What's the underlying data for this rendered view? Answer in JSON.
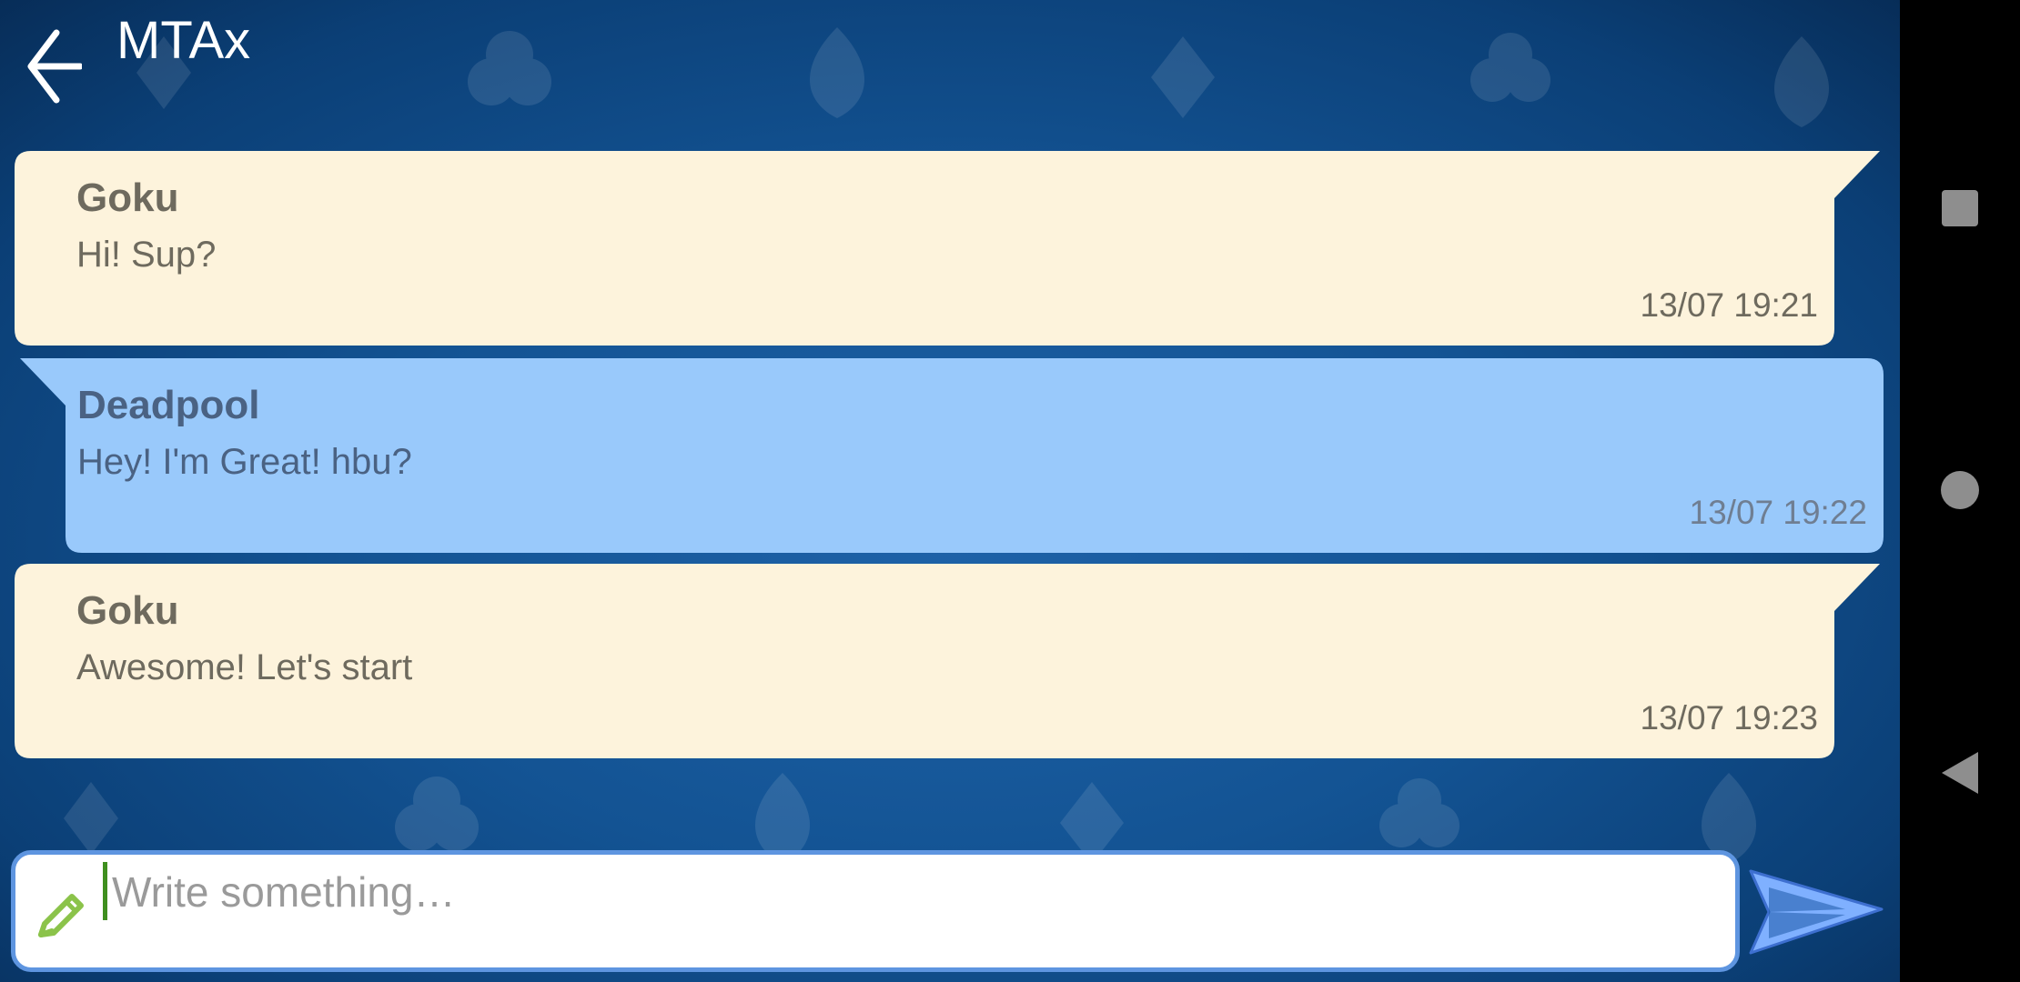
{
  "header": {
    "title": "MTAx",
    "back_icon": "arrow-left-icon"
  },
  "messages": [
    {
      "sender": "Goku",
      "text": "Hi! Sup?",
      "time": "13/07 19:21",
      "side": "incoming",
      "color": "#fdf3dc"
    },
    {
      "sender": "Deadpool",
      "text": "Hey! I'm Great! hbu?",
      "time": "13/07 19:22",
      "side": "outgoing",
      "color": "#99c9fb"
    },
    {
      "sender": "Goku",
      "text": "Awesome! Let's start",
      "time": "13/07 19:23",
      "side": "incoming",
      "color": "#fdf3dc"
    }
  ],
  "composer": {
    "placeholder": "Write something…",
    "value": "",
    "icon": "pencil-icon",
    "send_icon": "send-icon"
  },
  "system_nav": {
    "recents_icon": "square-icon",
    "home_icon": "circle-icon",
    "back_icon": "triangle-back-icon"
  },
  "colors": {
    "background": "#135393",
    "incoming_bubble": "#fdf3dc",
    "outgoing_bubble": "#99c9fb",
    "accent": "#5e95e0",
    "pencil": "#8bc34a"
  }
}
